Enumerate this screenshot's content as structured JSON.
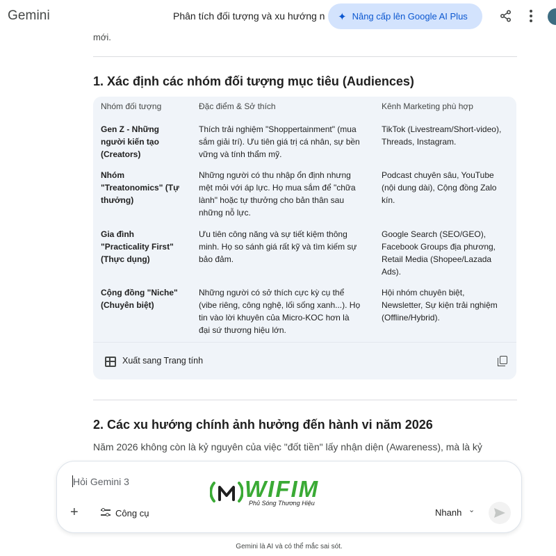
{
  "header": {
    "brand": "Gemini",
    "conversation_title": "Phân tích đối tượng và xu hướng n",
    "upgrade_label": "Nâng cấp lên Google AI Plus"
  },
  "main": {
    "cut_text": "mới.",
    "section1_title": "1. Xác định các nhóm đối tượng mục tiêu (Audiences)",
    "table": {
      "headers": [
        "Nhóm đối tượng",
        "Đặc điểm & Sở thích",
        "Kênh Marketing phù hợp"
      ],
      "rows": [
        {
          "group": [
            "Gen Z - Những",
            "người kiến tạo",
            "(Creators)"
          ],
          "traits": [
            "Thích trải nghiệm \"Shoppertainment\" (mua",
            "sắm giải trí). Ưu tiên giá trị cá nhân, sự bền",
            "vững và tính thẩm mỹ."
          ],
          "channels": [
            "TikTok (Livestream/Short-video),",
            "Threads, Instagram."
          ]
        },
        {
          "group": [
            "Nhóm",
            "\"Treatonomics\" (Tự",
            "thưởng)"
          ],
          "traits": [
            "Những người có thu nhập ổn định nhưng",
            "mệt mỏi với áp lực. Họ mua sắm để \"chữa",
            "lành\" hoặc tự thưởng cho bản thân sau",
            "những nỗ lực."
          ],
          "channels": [
            "Podcast chuyên sâu, YouTube",
            "(nội dung dài), Cộng đồng Zalo",
            "kín."
          ]
        },
        {
          "group": [
            "Gia đình",
            "\"Practicality First\"",
            "(Thực dụng)"
          ],
          "traits": [
            "Ưu tiên công năng và sự tiết kiệm thông",
            "minh. Họ so sánh giá rất kỹ và tìm kiếm sự",
            "bảo đảm."
          ],
          "channels": [
            "Google Search (SEO/GEO),",
            "Facebook Groups địa phương,",
            "Retail Media (Shopee/Lazada",
            "Ads)."
          ]
        },
        {
          "group": [
            "Cộng đồng \"Niche\"",
            "(Chuyên biệt)"
          ],
          "traits": [
            "Những người có sở thích cực kỳ cụ thể",
            "(vibe riêng, công nghệ, lối sống xanh...). Họ",
            "tin vào lời khuyên của Micro-KOC hơn là",
            "đại sứ thương hiệu lớn."
          ],
          "channels": [
            "Hội nhóm chuyên biệt,",
            "Newsletter, Sự kiện trải nghiệm",
            "(Offline/Hybrid)."
          ]
        }
      ],
      "export_label": "Xuất sang Trang tính"
    },
    "section2_title": "2. Các xu hướng chính ảnh hưởng đến hành vi năm 2026",
    "section2_paragraph": "Năm 2026 không còn là kỷ nguyên của việc \"đốt tiền\" lấy nhận diện (Awareness), mà là kỷ"
  },
  "composer": {
    "placeholder": "Hỏi Gemini 3",
    "tools_label": "Công cụ",
    "mode_label": "Nhanh"
  },
  "watermark": {
    "name": "WIFIM",
    "tagline": "Phủ Sóng Thương Hiệu"
  },
  "footer": {
    "disclaimer": "Gemini là AI và có thể mắc sai sót."
  },
  "colors": {
    "accent": "#0b57d0",
    "upgrade_bg": "#d3e3fd",
    "table_bg": "#f0f4f9",
    "watermark_green": "#3aaa35"
  }
}
